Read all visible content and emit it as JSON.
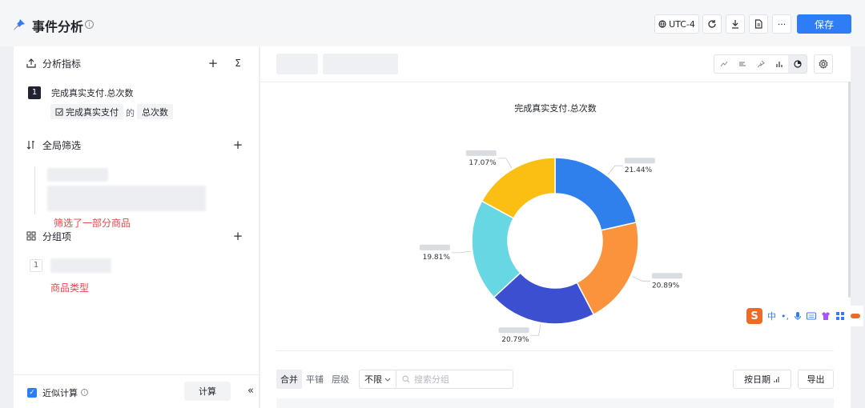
{
  "header": {
    "title": "事件分析",
    "info_icon": "info-icon",
    "timezone": "UTC-4",
    "save_label": "保存",
    "more_label": "···"
  },
  "left": {
    "metrics_section": "分析指标",
    "metric": {
      "index": "1",
      "name": "完成真实支付.总次数",
      "event_chip": "完成真实支付",
      "de": "的",
      "agg_chip": "总次数"
    },
    "filter_section": "全局筛选",
    "filter_note": "筛选了一部分商品",
    "group_section": "分组项",
    "group_index": "1",
    "group_note": "商品类型",
    "approx_label": "近似计算",
    "calc_label": "计算",
    "collapse_icon": "«",
    "add_icon": "+",
    "sigma_icon": "Σ"
  },
  "toolbar": {
    "chart_type_buttons": [
      "line-chart-icon",
      "bar-horizontal-icon",
      "pin-icon",
      "bar-chart-icon",
      "pie-chart-icon"
    ],
    "active_chart_type": "pie-chart-icon"
  },
  "table_controls": {
    "modes": [
      "合并",
      "平铺",
      "层级"
    ],
    "active_mode": "合并",
    "limit": "不限",
    "search_placeholder": "搜索分组",
    "date_label": "按日期",
    "export_label": "导出"
  },
  "chart_data": {
    "type": "pie",
    "donut": true,
    "title": "完成真实支付.总次数",
    "slices": [
      {
        "value": 21.44,
        "label": "21.44%",
        "color": "#2f80ed"
      },
      {
        "value": 20.89,
        "label": "20.89%",
        "color": "#fb923c"
      },
      {
        "value": 20.79,
        "label": "20.79%",
        "color": "#3b4fd0"
      },
      {
        "value": 19.81,
        "label": "19.81%",
        "color": "#67d8e3"
      },
      {
        "value": 17.07,
        "label": "17.07%",
        "color": "#fbbf14"
      }
    ]
  },
  "ime": {
    "logo": "S",
    "mode": "中"
  }
}
